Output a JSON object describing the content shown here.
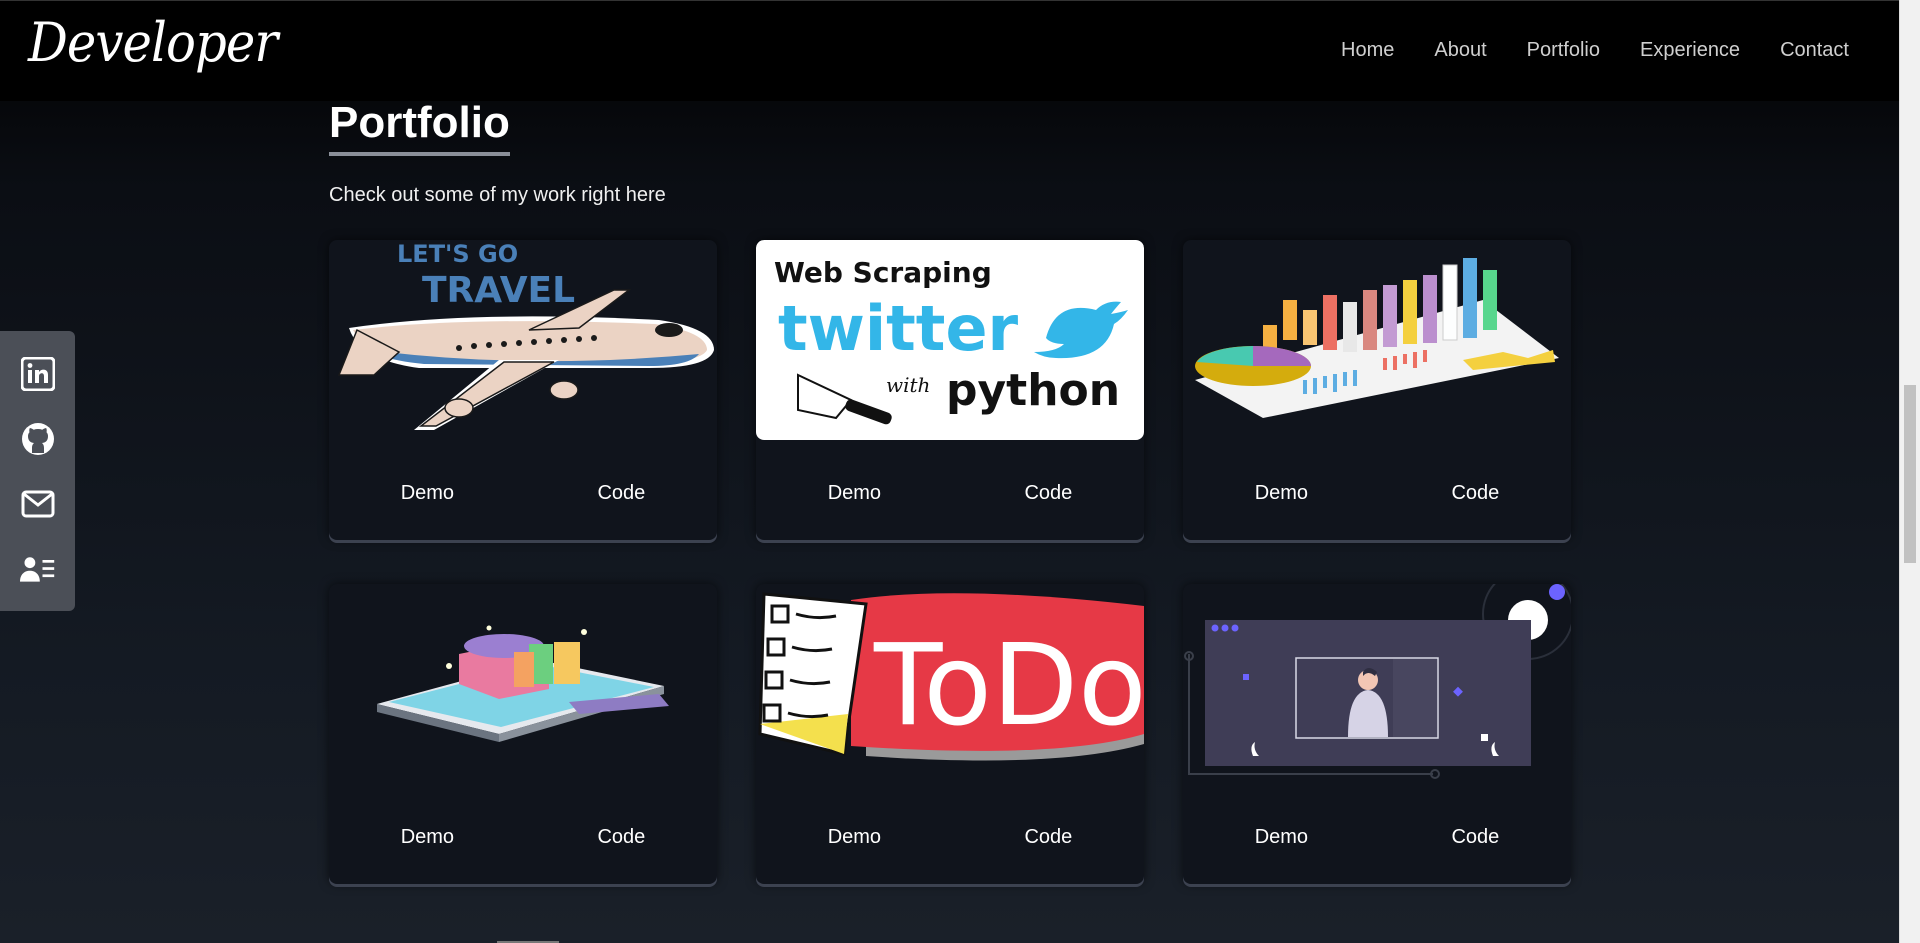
{
  "brand": {
    "logo_text": "Developer"
  },
  "nav": {
    "items": [
      {
        "label": "Home"
      },
      {
        "label": "About"
      },
      {
        "label": "Portfolio"
      },
      {
        "label": "Experience"
      },
      {
        "label": "Contact"
      }
    ]
  },
  "social": {
    "items": [
      {
        "icon": "linkedin-icon"
      },
      {
        "icon": "github-icon"
      },
      {
        "icon": "mail-icon"
      },
      {
        "icon": "resume-icon"
      }
    ]
  },
  "portfolio": {
    "title": "Portfolio",
    "subtitle": "Check out some of my work right here",
    "projects": [
      {
        "thumb_text_1": "LET'S GO",
        "thumb_text_2": "TRAVEL",
        "demo_label": "Demo",
        "code_label": "Code"
      },
      {
        "thumb_text_1": "Web Scraping",
        "thumb_text_2": "twitter",
        "thumb_text_3": "with",
        "thumb_text_4": "python",
        "demo_label": "Demo",
        "code_label": "Code"
      },
      {
        "demo_label": "Demo",
        "code_label": "Code"
      },
      {
        "demo_label": "Demo",
        "code_label": "Code"
      },
      {
        "thumb_text_1": "ToDo",
        "demo_label": "Demo",
        "code_label": "Code"
      },
      {
        "demo_label": "Demo",
        "code_label": "Code"
      }
    ]
  }
}
